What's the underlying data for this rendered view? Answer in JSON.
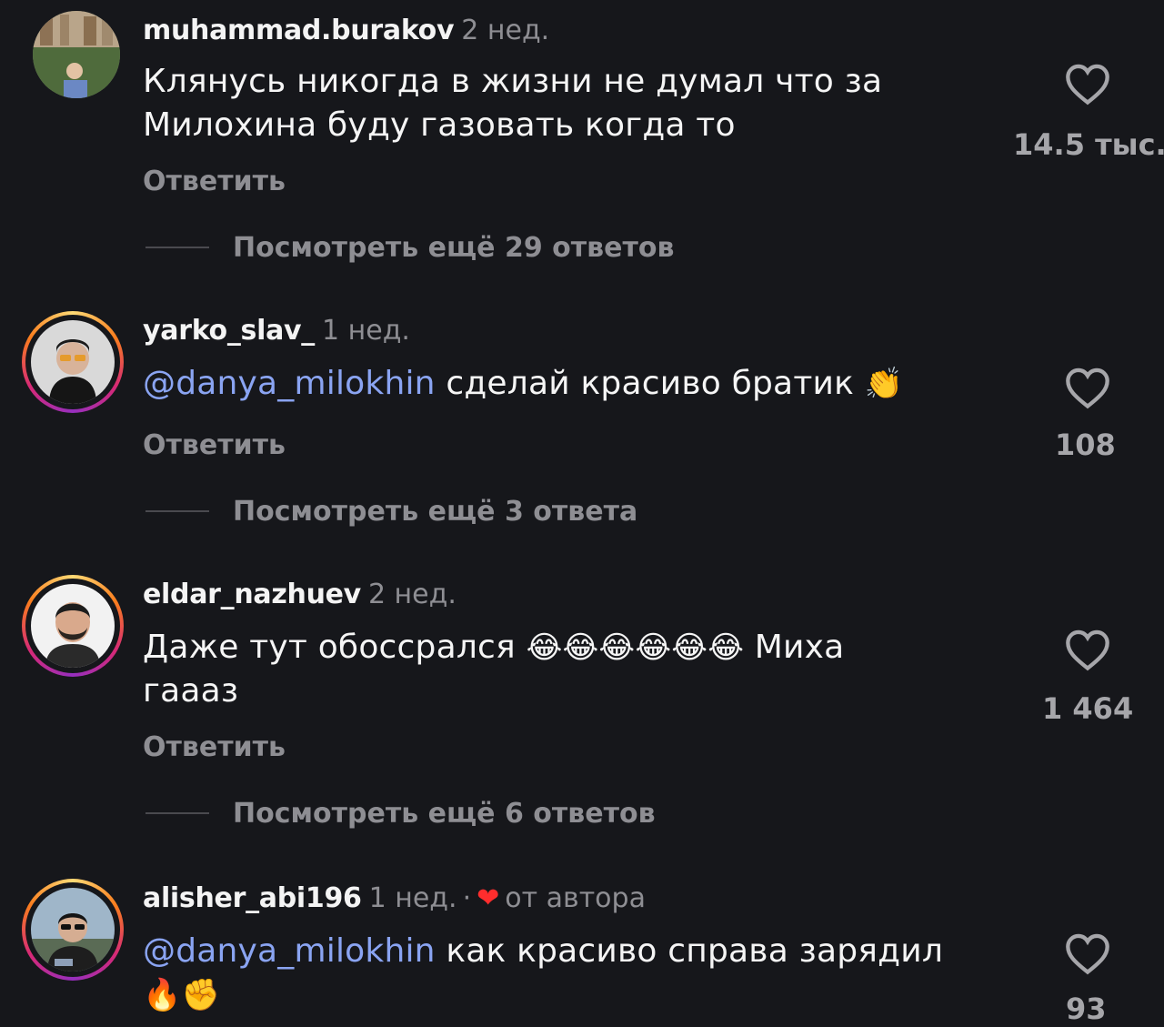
{
  "comments": [
    {
      "username": "muhammad.burakov",
      "time": "2 нед.",
      "line1": "Клянусь никогда в жизни не думал  что за",
      "line2": "Милохина буду газовать когда то",
      "reply": "Ответить",
      "likes": "14.5 тыс.",
      "view_more": "Посмотреть ещё 29 ответов"
    },
    {
      "username": "yarko_slav_",
      "time": "1 нед.",
      "mention": "@danya_milokhin",
      "text": " сделай красиво братик ",
      "emoji": "👏",
      "reply": "Ответить",
      "likes": "108",
      "view_more": "Посмотреть ещё 3 ответа"
    },
    {
      "username": "eldar_nazhuev",
      "time": "2 нед.",
      "line1_text": "Даже тут обоссрался ",
      "emojis": "😂😂😂😂😂😂",
      "line1_end": " Миха",
      "line2": "гаааз",
      "reply": "Ответить",
      "likes": "1 464",
      "view_more": "Посмотреть ещё 6 ответов"
    },
    {
      "username": "alisher_abi196",
      "time": "1 нед.",
      "separator": "·",
      "author_heart": "❤",
      "author_label": "от автора",
      "mention": "@danya_milokhin",
      "text": " как красиво справа зарядил",
      "emojis": "🔥✊",
      "likes": "93"
    }
  ],
  "colors": {
    "background": "#16171b",
    "mention": "#8aa4f2",
    "muted": "#8e8e93",
    "author_heart": "#ff2d2d"
  },
  "icons": {
    "like": "heart-outline-icon"
  }
}
